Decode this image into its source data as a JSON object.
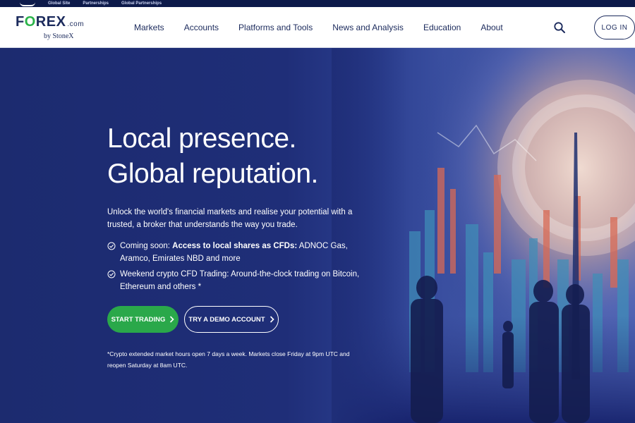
{
  "util_bar": {
    "links": [
      "Global Site",
      "Partnerships",
      "Global Partnerships"
    ]
  },
  "header": {
    "logo": {
      "brand_pre": "F",
      "brand_o": "O",
      "brand_post": "REX",
      "brand_suffix": ".com",
      "byline": "by StoneX"
    },
    "nav": [
      {
        "label": "Markets"
      },
      {
        "label": "Accounts"
      },
      {
        "label": "Platforms and Tools"
      },
      {
        "label": "News and Analysis"
      },
      {
        "label": "Education"
      },
      {
        "label": "About"
      }
    ],
    "search_icon": "search-icon",
    "login_label": "LOG IN"
  },
  "hero": {
    "title": "Local presence. Global reputation.",
    "description": "Unlock the world's financial markets and realise your potential with a trusted, a broker that understands the way you trade.",
    "bullets": [
      {
        "icon": "check-circle-icon",
        "lead": "Coming soon: ",
        "bold": "Access to local shares as CFDs:",
        "rest": " ADNOC Gas, Aramco, Emirates NBD and more"
      },
      {
        "icon": "check-circle-icon",
        "lead": "Weekend crypto CFD Trading: Around-the-clock trading on Bitcoin, Ethereum and others *",
        "bold": "",
        "rest": ""
      }
    ],
    "cta_start": "START TRADING",
    "cta_demo": "TRY A DEMO ACCOUNT",
    "cta_icon": "chevron-right-icon",
    "footnote": "*Crypto extended market hours open 7 days a week. Markets close Friday at 9pm UTC and reopen Saturday at 8am UTC."
  },
  "colors": {
    "brand_navy": "#1b2a5c",
    "brand_green": "#2bb34a",
    "hero_bg": "#1f2e78",
    "cta_green": "#2aa84a"
  }
}
